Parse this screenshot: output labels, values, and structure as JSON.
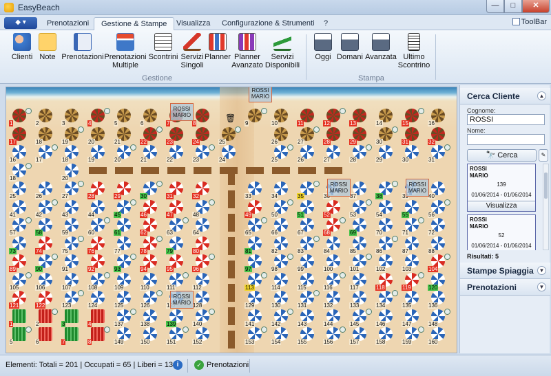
{
  "window": {
    "title": "EasyBeach",
    "min": "—",
    "max": "□",
    "close": "✕"
  },
  "app_menu": {
    "label": "◆ ▾"
  },
  "tabs": [
    {
      "label": "Prenotazioni",
      "active": false
    },
    {
      "label": "Gestione & Stampe",
      "active": true
    },
    {
      "label": "Visualizza",
      "active": false
    },
    {
      "label": "Configurazione & Strumenti",
      "active": false
    },
    {
      "label": "?",
      "active": false
    }
  ],
  "toolbar_toggle": {
    "label": "ToolBar"
  },
  "ribbon": {
    "gestione": {
      "label": "Gestione",
      "buttons": [
        {
          "label": "Clienti",
          "icon": "clients-icon"
        },
        {
          "label": "Note",
          "icon": "note-icon"
        },
        {
          "label": "Prenotazioni",
          "icon": "booking-icon"
        },
        {
          "label": "Prenotazioni\nMultiple",
          "icon": "multiple-booking-icon"
        },
        {
          "label": "Scontrini",
          "icon": "receipt-icon"
        },
        {
          "label": "Servizi\nSingoli",
          "icon": "deckchair-icon"
        },
        {
          "label": "Planner",
          "icon": "planner-icon"
        },
        {
          "label": "Planner\nAvanzato",
          "icon": "advanced-planner-icon"
        },
        {
          "label": "Servizi\nDisponibili",
          "icon": "available-services-icon"
        }
      ]
    },
    "stampa": {
      "label": "Stampa",
      "buttons": [
        {
          "label": "Oggi",
          "icon": "print-today-icon"
        },
        {
          "label": "Domani",
          "icon": "print-tomorrow-icon"
        },
        {
          "label": "Avanzata",
          "icon": "print-advanced-icon"
        },
        {
          "label": "Ultimo\nScontrino",
          "icon": "last-receipt-icon"
        }
      ]
    }
  },
  "map": {
    "customer_tags": [
      {
        "text": "ROSSI\nMARIO"
      },
      {
        "text": "ROSSI\nMARIO"
      },
      {
        "text": "ROSSI\nMARIO"
      },
      {
        "text": "ROSSI\nMARIO"
      },
      {
        "text": "ROSSI\nMARIO"
      }
    ],
    "beach_icon": "🗑",
    "rows": [
      {
        "type": "straw",
        "nums": [
          "1",
          "2",
          "3",
          "4",
          "5",
          "6",
          "7",
          "8",
          "",
          "9",
          "10",
          "11",
          "12",
          "13",
          "14",
          "15",
          "16"
        ]
      },
      {
        "type": "straw",
        "nums": [
          "17",
          "18",
          "19",
          "20",
          "21",
          "22",
          "23",
          "24",
          "25",
          "",
          "26",
          "27",
          "28",
          "29",
          "30",
          "31",
          "32",
          "33"
        ]
      },
      {
        "type": "blue",
        "nums": [
          "16",
          "17",
          "18",
          "19",
          "20",
          "21",
          "22",
          "23",
          "24",
          "",
          "25",
          "26",
          "27",
          "28",
          "29",
          "30",
          "31",
          "32"
        ]
      },
      {
        "type": "blue",
        "nums": [
          "18",
          "",
          "20",
          "",
          "",
          "",
          "",
          "",
          "",
          "",
          "",
          "",
          "",
          "",
          "",
          "",
          "",
          ""
        ]
      },
      {
        "type": "blue",
        "nums": [
          "25",
          "26",
          "27",
          "28",
          "29",
          "30",
          "31",
          "32",
          "",
          "33",
          "34",
          "35",
          "36",
          "37",
          "38",
          "39",
          "40"
        ]
      },
      {
        "type": "blue",
        "nums": [
          "41",
          "42",
          "43",
          "44",
          "45",
          "46",
          "47",
          "48",
          "",
          "49",
          "50",
          "51",
          "52",
          "53",
          "54",
          "55",
          "56"
        ]
      },
      {
        "type": "blue",
        "nums": [
          "57",
          "58",
          "59",
          "60",
          "61",
          "62",
          "63",
          "64",
          "",
          "65",
          "66",
          "67",
          "68",
          "69",
          "70",
          "71",
          "72"
        ]
      },
      {
        "type": "blue",
        "nums": [
          "73",
          "74",
          "75",
          "76",
          "77",
          "78",
          "79",
          "80",
          "",
          "81",
          "82",
          "83",
          "84",
          "85",
          "86",
          "87",
          "88"
        ]
      },
      {
        "type": "blue",
        "nums": [
          "89",
          "90",
          "91",
          "92",
          "93",
          "94",
          "95",
          "96",
          "",
          "97",
          "98",
          "99",
          "100",
          "101",
          "102",
          "103",
          "104"
        ]
      },
      {
        "type": "blue",
        "nums": [
          "105",
          "106",
          "107",
          "108",
          "109",
          "110",
          "111",
          "112",
          "",
          "113",
          "114",
          "115",
          "116",
          "117",
          "118",
          "119",
          "120"
        ]
      },
      {
        "type": "blue",
        "nums": [
          "121",
          "122",
          "123",
          "124",
          "125",
          "126",
          "127",
          "128",
          "",
          "129",
          "130",
          "131",
          "132",
          "133",
          "134",
          "135",
          "136"
        ]
      },
      {
        "type": "cabin",
        "nums": [
          "1",
          "2",
          "3",
          "4",
          "137",
          "138",
          "139",
          "140",
          "",
          "141",
          "142",
          "143",
          "144",
          "145",
          "146",
          "147",
          "148"
        ]
      },
      {
        "type": "cabin",
        "nums": [
          "5",
          "6",
          "7",
          "8",
          "149",
          "150",
          "151",
          "152",
          "",
          "153",
          "154",
          "155",
          "156",
          "157",
          "158",
          "159",
          "160"
        ]
      }
    ]
  },
  "side_panel": {
    "search": {
      "title": "Cerca Cliente",
      "surname_label": "Cognome:",
      "surname_value": "ROSSI",
      "name_label": "Nome:",
      "name_value": "",
      "search_button": "Cerca",
      "clear_icon": "✎",
      "results": [
        {
          "surname": "ROSSI",
          "name": "MARIO",
          "post": "139",
          "dates": "01/06/2014 - 01/06/2014",
          "button": "Visualizza"
        },
        {
          "surname": "ROSSI",
          "name": "MARIO",
          "post": "52",
          "dates": "01/06/2014 - 01/06/2014"
        }
      ],
      "results_count": "Risultati: 5"
    },
    "stampe": {
      "title": "Stampe Spiaggia"
    },
    "prenotazioni": {
      "title": "Prenotazioni"
    }
  },
  "statusbar": {
    "elements": "Elementi: Totali = 201 | Occupati = 65 | Liberi = 136",
    "info": "i",
    "ok": "✓",
    "prenotazioni": "Prenotazioni"
  }
}
